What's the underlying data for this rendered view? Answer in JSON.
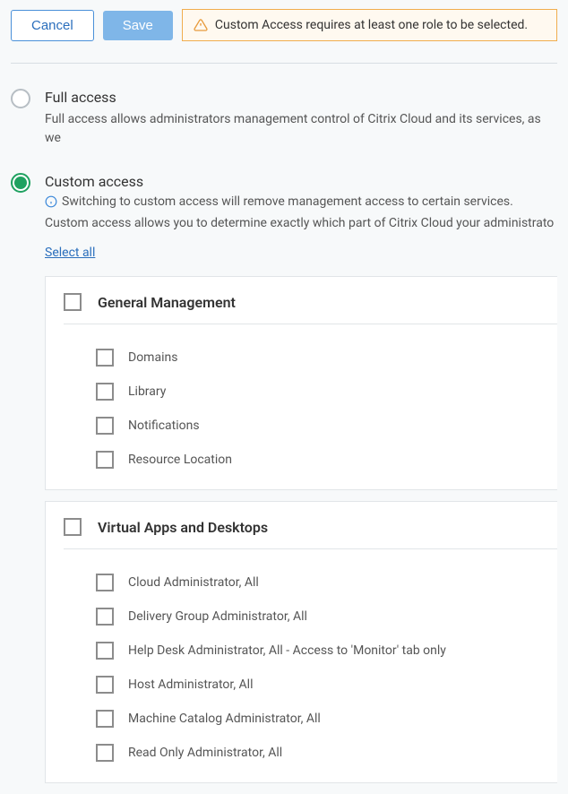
{
  "toolbar": {
    "cancel_label": "Cancel",
    "save_label": "Save",
    "warning_text": "Custom Access requires at least one role to be selected."
  },
  "options": {
    "full": {
      "title": "Full access",
      "desc": "Full access allows administrators management control of Citrix Cloud and its services, as we"
    },
    "custom": {
      "title": "Custom access",
      "info": "Switching to custom access will remove management access to certain services.",
      "desc": "Custom access allows you to determine exactly which part of Citrix Cloud your administrato",
      "select_all_label": "Select all"
    }
  },
  "sections": [
    {
      "title": "General Management",
      "items": [
        "Domains",
        "Library",
        "Notifications",
        "Resource Location"
      ]
    },
    {
      "title": "Virtual Apps and Desktops",
      "items": [
        "Cloud Administrator, All",
        "Delivery Group Administrator, All",
        "Help Desk Administrator, All - Access to 'Monitor' tab only",
        "Host Administrator, All",
        "Machine Catalog Administrator, All",
        "Read Only Administrator, All"
      ]
    }
  ]
}
